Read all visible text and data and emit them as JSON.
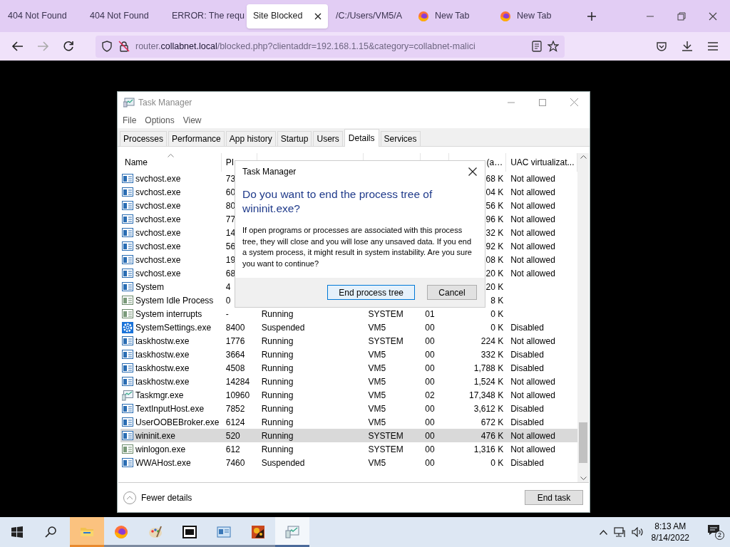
{
  "browser": {
    "tabs": [
      {
        "label": "404 Not Found",
        "selected": false,
        "kind": "page"
      },
      {
        "label": "404 Not Found",
        "selected": false,
        "kind": "page"
      },
      {
        "label": "ERROR: The requ",
        "selected": false,
        "kind": "page"
      },
      {
        "label": "Site Blocked",
        "selected": true,
        "kind": "page"
      },
      {
        "label": "/C:/Users/VM5/A",
        "selected": false,
        "kind": "page"
      },
      {
        "label": "New Tab",
        "selected": false,
        "kind": "firefox"
      },
      {
        "label": "New Tab",
        "selected": false,
        "kind": "firefox"
      }
    ],
    "url": {
      "host_start": "router.",
      "domain": "collabnet.local",
      "rest": "/blocked.php?clientaddr=192.168.1.15&category=collabnet-malici"
    }
  },
  "task_manager": {
    "title": "Task Manager",
    "menu": [
      "File",
      "Options",
      "View"
    ],
    "tabs": [
      {
        "label": "Processes",
        "selected": false
      },
      {
        "label": "Performance",
        "selected": false
      },
      {
        "label": "App history",
        "selected": false
      },
      {
        "label": "Startup",
        "selected": false
      },
      {
        "label": "Users",
        "selected": false
      },
      {
        "label": "Details",
        "selected": true
      },
      {
        "label": "Services",
        "selected": false
      }
    ],
    "columns": [
      {
        "label": "Name"
      },
      {
        "label": "PI"
      },
      {},
      {},
      {},
      {
        "label": "(a…"
      },
      {
        "label": "UAC virtualizat..."
      }
    ],
    "rows": [
      {
        "kind": "window",
        "name": "svchost.exe",
        "pid": "73",
        "memory": "68 K",
        "uac": "Not allowed",
        "selected": false
      },
      {
        "kind": "window",
        "name": "svchost.exe",
        "pid": "60",
        "memory": "04 K",
        "uac": "Not allowed",
        "selected": false
      },
      {
        "kind": "window",
        "name": "svchost.exe",
        "pid": "80",
        "memory": "56 K",
        "uac": "Not allowed",
        "selected": false
      },
      {
        "kind": "window",
        "name": "svchost.exe",
        "pid": "77",
        "memory": "96 K",
        "uac": "Not allowed",
        "selected": false
      },
      {
        "kind": "window",
        "name": "svchost.exe",
        "pid": "14",
        "memory": "32 K",
        "uac": "Not allowed",
        "selected": false
      },
      {
        "kind": "window",
        "name": "svchost.exe",
        "pid": "56",
        "memory": "92 K",
        "uac": "Not allowed",
        "selected": false
      },
      {
        "kind": "window",
        "name": "svchost.exe",
        "pid": "19",
        "memory": "08 K",
        "uac": "Not allowed",
        "selected": false
      },
      {
        "kind": "window",
        "name": "svchost.exe",
        "pid": "68",
        "memory": "20 K",
        "uac": "Not allowed",
        "selected": false
      },
      {
        "kind": "window",
        "name": "System",
        "pid": "4",
        "memory": "20 K",
        "selected": false
      },
      {
        "kind": "plain",
        "name": "System Idle Process",
        "pid": "0",
        "memory": "8 K",
        "selected": false
      },
      {
        "kind": "plain",
        "name": "System interrupts",
        "pid": "-",
        "status": "Running",
        "user": "SYSTEM",
        "cpu": "01",
        "memory": "0 K",
        "selected": false
      },
      {
        "kind": "gear",
        "name": "SystemSettings.exe",
        "pid": "8400",
        "status": "Suspended",
        "user": "VM5",
        "cpu": "00",
        "memory": "0 K",
        "uac": "Disabled",
        "selected": false
      },
      {
        "kind": "window",
        "name": "taskhostw.exe",
        "pid": "1776",
        "status": "Running",
        "user": "SYSTEM",
        "cpu": "00",
        "memory": "224 K",
        "uac": "Not allowed",
        "selected": false
      },
      {
        "kind": "window",
        "name": "taskhostw.exe",
        "pid": "3664",
        "status": "Running",
        "user": "VM5",
        "cpu": "00",
        "memory": "332 K",
        "uac": "Disabled",
        "selected": false
      },
      {
        "kind": "window",
        "name": "taskhostw.exe",
        "pid": "4508",
        "status": "Running",
        "user": "VM5",
        "cpu": "00",
        "memory": "1,788 K",
        "uac": "Disabled",
        "selected": false
      },
      {
        "kind": "window",
        "name": "taskhostw.exe",
        "pid": "14284",
        "status": "Running",
        "user": "VM5",
        "cpu": "00",
        "memory": "1,524 K",
        "uac": "Not allowed",
        "selected": false
      },
      {
        "kind": "monitor",
        "name": "Taskmgr.exe",
        "pid": "10960",
        "status": "Running",
        "user": "VM5",
        "cpu": "02",
        "memory": "17,348 K",
        "uac": "Not allowed",
        "selected": false
      },
      {
        "kind": "window",
        "name": "TextInputHost.exe",
        "pid": "7852",
        "status": "Running",
        "user": "VM5",
        "cpu": "00",
        "memory": "3,612 K",
        "uac": "Disabled",
        "selected": false
      },
      {
        "kind": "window",
        "name": "UserOOBEBroker.exe",
        "pid": "6124",
        "status": "Running",
        "user": "VM5",
        "cpu": "00",
        "memory": "672 K",
        "uac": "Disabled",
        "selected": false
      },
      {
        "kind": "window",
        "name": "wininit.exe",
        "pid": "520",
        "status": "Running",
        "user": "SYSTEM",
        "cpu": "00",
        "memory": "476 K",
        "uac": "Not allowed",
        "selected": true
      },
      {
        "kind": "plain",
        "name": "winlogon.exe",
        "pid": "612",
        "status": "Running",
        "user": "SYSTEM",
        "cpu": "00",
        "memory": "1,316 K",
        "uac": "Not allowed",
        "selected": false
      },
      {
        "kind": "window",
        "name": "WWAHost.exe",
        "pid": "7460",
        "status": "Suspended",
        "user": "VM5",
        "cpu": "00",
        "memory": "0 K",
        "uac": "Disabled",
        "selected": false
      }
    ],
    "fewer_details": "Fewer details",
    "end_task": "End task"
  },
  "dialog": {
    "title": "Task Manager",
    "heading": "Do you want to end the process tree of wininit.exe?",
    "message": "If open programs or processes are associated with this process tree, they will close and you will lose any unsaved data. If you end a system process, it might result in system instability. Are you sure you want to continue?",
    "buttons": [
      {
        "label": "End process tree",
        "default": true
      },
      {
        "label": "Cancel",
        "default": false
      }
    ]
  },
  "taskbar": {
    "apps": [
      {
        "kind": "folder",
        "active": true,
        "selected": false
      },
      {
        "kind": "firefox",
        "active": false,
        "selected": false
      },
      {
        "kind": "paint",
        "active": false,
        "selected": false
      },
      {
        "kind": "archive",
        "active": false,
        "selected": false
      },
      {
        "kind": "window",
        "active": false,
        "selected": false
      },
      {
        "kind": "game",
        "active": false,
        "selected": false
      },
      {
        "kind": "monitor",
        "active": false,
        "selected": true
      }
    ],
    "time": "8:13 AM",
    "date": "8/14/2022",
    "notifications": "2"
  }
}
